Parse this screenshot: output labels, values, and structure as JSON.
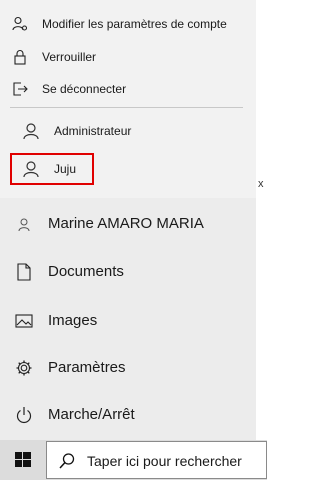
{
  "account_menu": {
    "items": [
      {
        "label": "Modifier les paramètres de compte",
        "icon": "user-settings-icon"
      },
      {
        "label": "Verrouiller",
        "icon": "lock-icon"
      },
      {
        "label": "Se déconnecter",
        "icon": "sign-out-icon"
      }
    ]
  },
  "switch_users": [
    {
      "label": "Administrateur",
      "icon": "user-icon"
    },
    {
      "label": "Juju",
      "icon": "user-icon"
    }
  ],
  "highlight_color": "#e00000",
  "side_fragment": "x",
  "start_menu": {
    "items": [
      {
        "label": "Marine AMARO MARIA",
        "icon": "user-icon"
      },
      {
        "label": "Documents",
        "icon": "document-icon"
      },
      {
        "label": "Images",
        "icon": "image-icon"
      },
      {
        "label": "Paramètres",
        "icon": "gear-icon"
      },
      {
        "label": "Marche/Arrêt",
        "icon": "power-icon"
      }
    ]
  },
  "taskbar": {
    "search_placeholder": "Taper ici pour rechercher"
  }
}
